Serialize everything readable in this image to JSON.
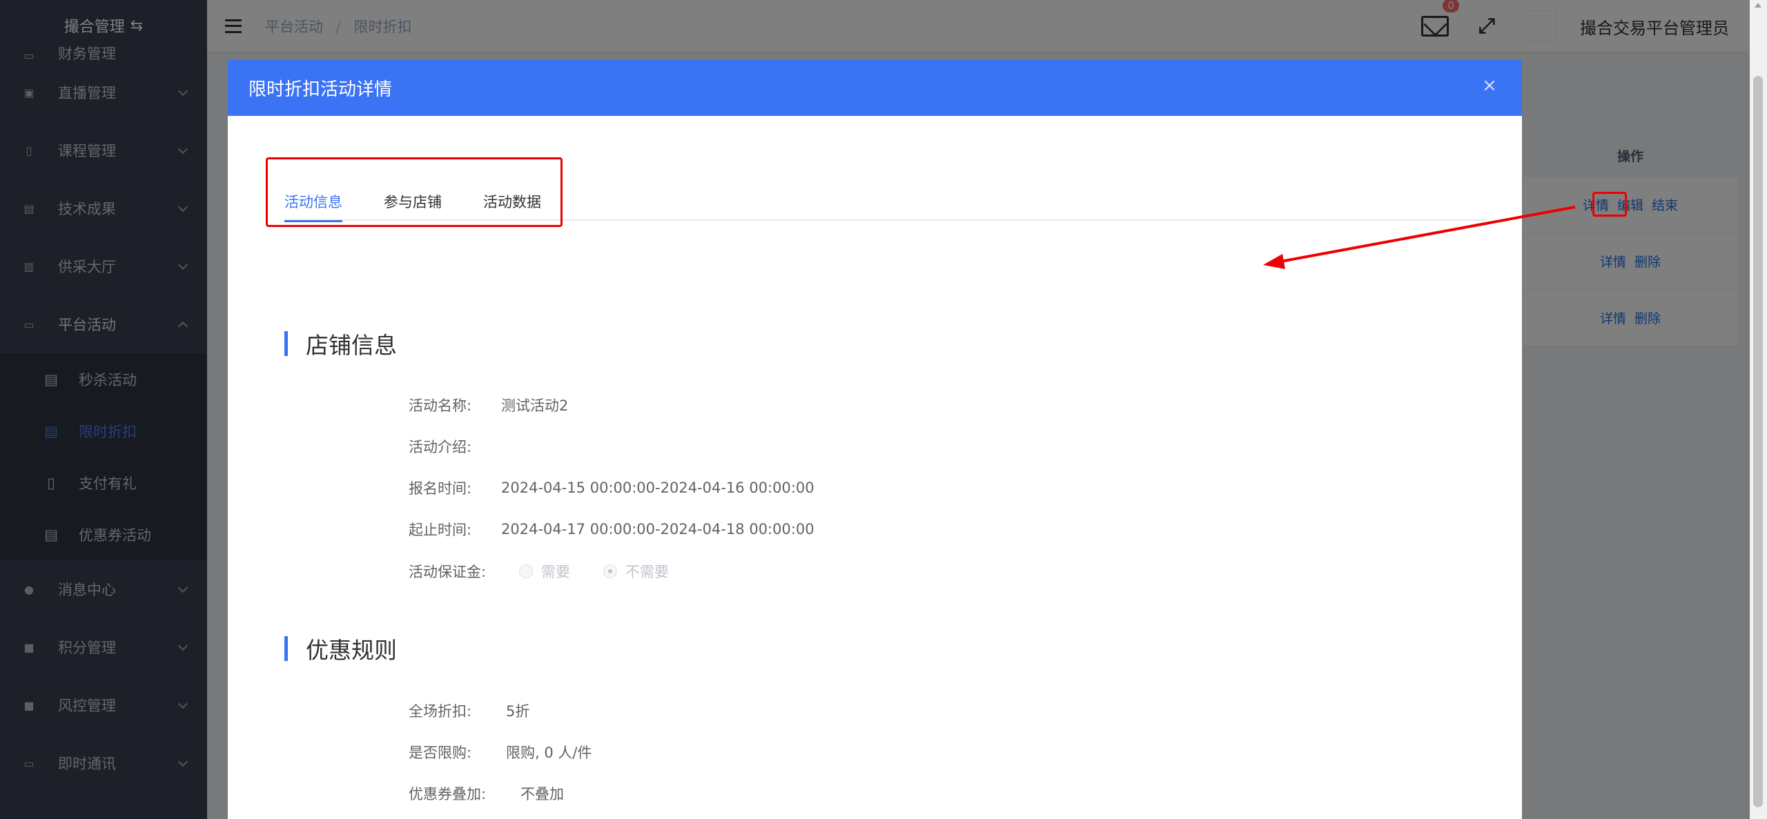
{
  "sidebar": {
    "header_title": "撮合管理",
    "partial_item": "财务管理",
    "items": [
      {
        "label": "直播管理"
      },
      {
        "label": "课程管理"
      },
      {
        "label": "技术成果"
      },
      {
        "label": "供采大厅"
      },
      {
        "label": "平台活动"
      }
    ],
    "sub_items": [
      {
        "label": "秒杀活动"
      },
      {
        "label": "限时折扣"
      },
      {
        "label": "支付有礼"
      },
      {
        "label": "优惠券活动"
      }
    ],
    "items_after": [
      {
        "label": "消息中心"
      },
      {
        "label": "积分管理"
      },
      {
        "label": "风控管理"
      },
      {
        "label": "即时通讯"
      }
    ]
  },
  "topbar": {
    "breadcrumb": [
      "平台活动",
      "限时折扣"
    ],
    "mail_badge": "0",
    "username": "撮合交易平台管理员"
  },
  "bg_table": {
    "header": "操作",
    "rows": [
      [
        "详情",
        "编辑",
        "结束"
      ],
      [
        "详情",
        "删除"
      ],
      [
        "详情",
        "删除"
      ]
    ]
  },
  "dialog": {
    "title": "限时折扣活动详情",
    "close": "×",
    "tabs": [
      {
        "label": "活动信息",
        "active": true
      },
      {
        "label": "参与店铺",
        "active": false
      },
      {
        "label": "活动数据",
        "active": false
      }
    ],
    "section1": {
      "title": "店铺信息",
      "fields": [
        {
          "label": "活动名称:",
          "value": "测试活动2"
        },
        {
          "label": "活动介绍:",
          "value": ""
        },
        {
          "label": "报名时间:",
          "value": "2024-04-15 00:00:00-2024-04-16 00:00:00"
        },
        {
          "label": "起止时间:",
          "value": "2024-04-17 00:00:00-2024-04-18 00:00:00"
        }
      ],
      "deposit_label": "活动保证金:",
      "deposit_options": [
        {
          "label": "需要",
          "checked": false
        },
        {
          "label": "不需要",
          "checked": true
        }
      ]
    },
    "section2": {
      "title": "优惠规则",
      "fields": [
        {
          "label": "全场折扣:",
          "value": "5折"
        },
        {
          "label": "是否限购:",
          "value": "限购, 0 人/件"
        },
        {
          "label": "优惠券叠加:",
          "value": "不叠加"
        }
      ]
    }
  },
  "colors": {
    "primary": "#3b73f5",
    "sidebar_bg": "#3a4150",
    "annotation_red": "#e00000"
  }
}
